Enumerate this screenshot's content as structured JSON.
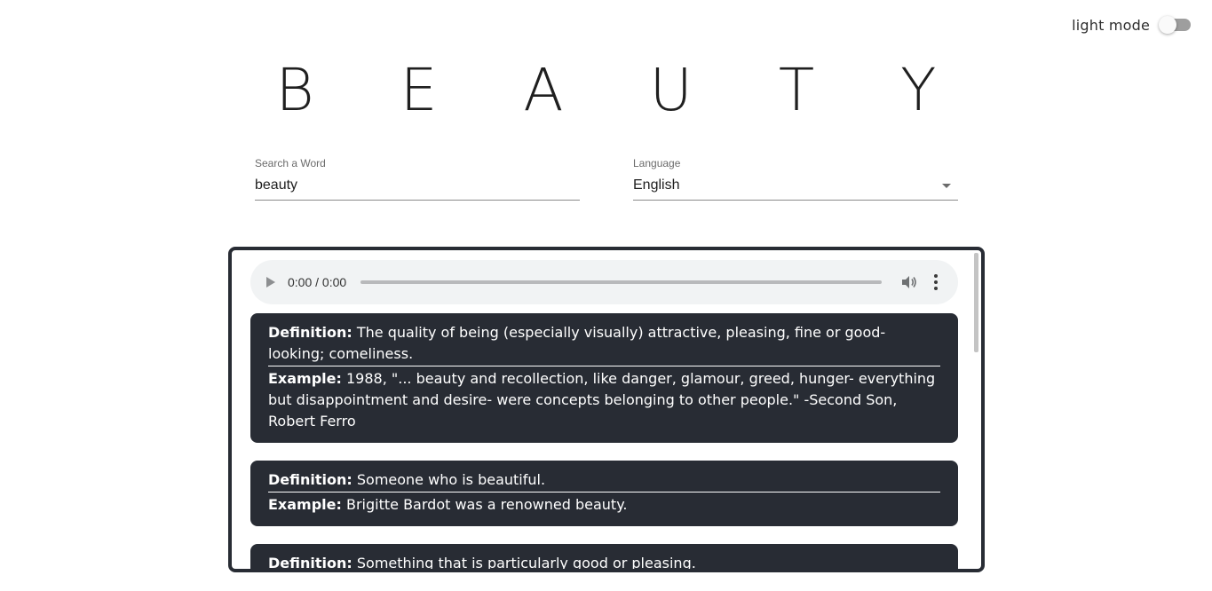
{
  "theme": {
    "toggle_label": "light mode"
  },
  "title": "B E A U T Y",
  "search": {
    "label": "Search a Word",
    "value": "beauty"
  },
  "language": {
    "label": "Language",
    "selected": "English"
  },
  "audio": {
    "time": "0:00 / 0:00"
  },
  "definitions": [
    {
      "definition_label": "Definition:",
      "definition": "The quality of being (especially visually) attractive, pleasing, fine or good-looking; comeliness.",
      "example_label": "Example:",
      "example": "1988, \"... beauty and recollection, like danger, glamour, greed, hunger- everything but disappointment and desire- were concepts belonging to other people.\" -Second Son, Robert Ferro"
    },
    {
      "definition_label": "Definition:",
      "definition": "Someone who is beautiful.",
      "example_label": "Example:",
      "example": "Brigitte Bardot was a renowned beauty."
    },
    {
      "definition_label": "Definition:",
      "definition": "Something that is particularly good or pleasing.",
      "example_label": "",
      "example": ""
    }
  ],
  "colors": {
    "card_bg": "#282c34",
    "panel_border": "#282c34",
    "audio_bg": "#f1f3f4"
  }
}
